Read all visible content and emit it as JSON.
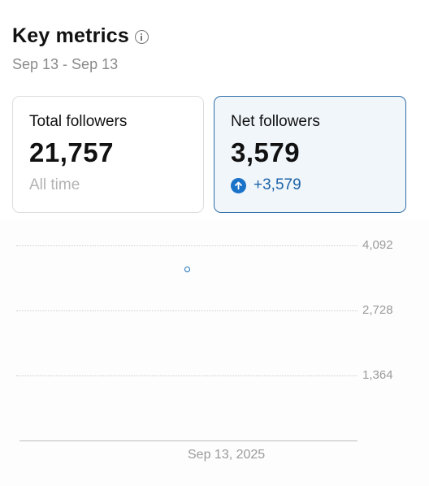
{
  "header": {
    "title": "Key metrics",
    "date_range": "Sep 13 - Sep 13"
  },
  "cards": {
    "total": {
      "label": "Total followers",
      "value": "21,757",
      "sub": "All time"
    },
    "net": {
      "label": "Net followers",
      "value": "3,579",
      "delta": "+3,579"
    }
  },
  "chart_data": {
    "type": "scatter",
    "x": [
      "Sep 13, 2025"
    ],
    "series": [
      {
        "values": [
          3579
        ]
      }
    ],
    "y_ticks": [
      "4,092",
      "2,728",
      "1,364"
    ],
    "ylim": [
      0,
      4092
    ],
    "grid": true,
    "color": "#1b6fb8"
  }
}
